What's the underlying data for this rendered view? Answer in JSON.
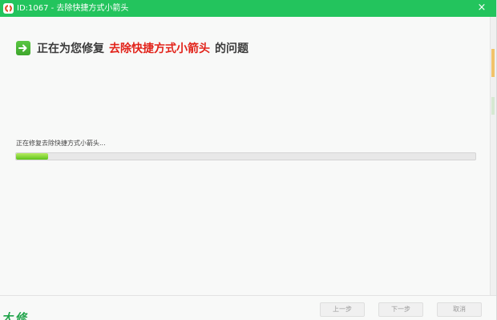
{
  "window": {
    "title": "ID:1067 - 去除快捷方式小箭头",
    "close_label": "×"
  },
  "heading": {
    "prefix": "正在为您修复",
    "highlight": "去除快捷方式小箭头",
    "suffix": "的问题",
    "icon": "right-arrow-icon"
  },
  "progress": {
    "status": "正在修复去除快捷方式小箭头...",
    "value": 0.07,
    "fill_color": "#7ed12e"
  },
  "footer": {
    "logo_text": "大 修",
    "prev_label": "上一步",
    "next_label": "下一步",
    "cancel_label": "取消"
  },
  "colors": {
    "titlebar": "#23c45d",
    "highlight": "#e2231a"
  }
}
